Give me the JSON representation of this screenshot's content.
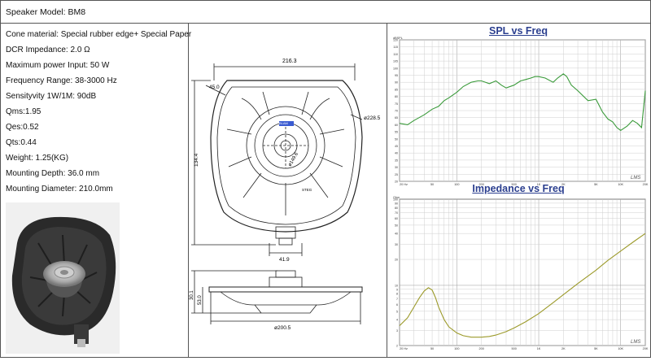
{
  "header": {
    "model": "Speaker Model: BM8"
  },
  "specs": [
    "Cone material: Special rubber edge+ Special Paper",
    "DCR Impedance: 2.0 Ω",
    "Maximum power Input: 50 W",
    "Frequency Range: 38-3000 Hz",
    "Sensityvity 1W/1M: 90dB",
    "Qms:1.95",
    "Qes:0.52",
    "Qts:0.44",
    "Weight: 1.25(KG)",
    "Mounting Depth: 36.0 mm",
    "Mounting Diameter: 210.0mm"
  ],
  "drawing": {
    "dim_width": "216.3",
    "dim_angle": "45.0",
    "dim_outer_dia": "ø228.5",
    "dim_inner": "ø149.6",
    "dim_height": "134.4",
    "dim_terminal": "41.9",
    "dim_depth1": "30.1",
    "dim_depth2": "53.0",
    "dim_base_dia": "ø200.5",
    "label_sticker": "BLAM",
    "label_brand": "STEG"
  },
  "chart_data": [
    {
      "type": "line",
      "title": "SPL vs Freq",
      "ylabel": "dBSPL",
      "watermark": "LMS",
      "xscale": "log",
      "xlim": [
        20,
        20000
      ],
      "ylim": [
        20,
        120
      ],
      "yticks": [
        20,
        25,
        30,
        35,
        40,
        45,
        50,
        55,
        60,
        65,
        70,
        75,
        80,
        85,
        90,
        95,
        100,
        105,
        110,
        115,
        120
      ],
      "xtick_labels": [
        {
          "v": 20,
          "t": "20 Hz"
        },
        {
          "v": 50,
          "t": "50"
        },
        {
          "v": 100,
          "t": "100"
        },
        {
          "v": 200,
          "t": "200"
        },
        {
          "v": 500,
          "t": "500"
        },
        {
          "v": 1000,
          "t": "1K"
        },
        {
          "v": 2000,
          "t": "2K"
        },
        {
          "v": 5000,
          "t": "5K"
        },
        {
          "v": 10000,
          "t": "10K"
        },
        {
          "v": 20000,
          "t": "20K"
        }
      ],
      "color": "#3a9a3a",
      "grid": true,
      "series": [
        {
          "x": [
            20,
            25,
            30,
            40,
            50,
            60,
            70,
            80,
            100,
            120,
            150,
            180,
            200,
            250,
            300,
            350,
            400,
            500,
            600,
            700,
            800,
            900,
            1000,
            1200,
            1500,
            1700,
            2000,
            2200,
            2500,
            3000,
            4000,
            5000,
            6000,
            7000,
            8000,
            9000,
            10000,
            12000,
            14000,
            16000,
            18000,
            20000
          ],
          "y": [
            61,
            60,
            63,
            67,
            71,
            73,
            77,
            79,
            83,
            87,
            90,
            91,
            91,
            89,
            91,
            88,
            86,
            88,
            91,
            92,
            93,
            94,
            94,
            93,
            90,
            93,
            96,
            94,
            88,
            84,
            77,
            78,
            69,
            64,
            62,
            58,
            56,
            59,
            63,
            61,
            58,
            84
          ]
        }
      ]
    },
    {
      "type": "line",
      "title": "Impedance vs Freq",
      "ylabel": "Ohm",
      "watermark": "LMS",
      "xscale": "log",
      "yscale": "log",
      "xlim": [
        20,
        20000
      ],
      "ylim": [
        2,
        100
      ],
      "ytick_labels": [
        {
          "v": 2,
          "t": "2"
        },
        {
          "v": 3,
          "t": "3"
        },
        {
          "v": 4,
          "t": "4"
        },
        {
          "v": 5,
          "t": "5"
        },
        {
          "v": 6,
          "t": "6"
        },
        {
          "v": 7,
          "t": "7"
        },
        {
          "v": 8,
          "t": "8"
        },
        {
          "v": 9,
          "t": "9"
        },
        {
          "v": 10,
          "t": "10"
        },
        {
          "v": 20,
          "t": "20"
        },
        {
          "v": 30,
          "t": "30"
        },
        {
          "v": 40,
          "t": "40"
        },
        {
          "v": 50,
          "t": "50"
        },
        {
          "v": 60,
          "t": "60"
        },
        {
          "v": 70,
          "t": "70"
        },
        {
          "v": 80,
          "t": "80"
        },
        {
          "v": 90,
          "t": "90"
        },
        {
          "v": 100,
          "t": "100"
        }
      ],
      "xtick_labels": [
        {
          "v": 20,
          "t": "20 Hz"
        },
        {
          "v": 50,
          "t": "50"
        },
        {
          "v": 100,
          "t": "100"
        },
        {
          "v": 200,
          "t": "200"
        },
        {
          "v": 500,
          "t": "500"
        },
        {
          "v": 1000,
          "t": "1K"
        },
        {
          "v": 2000,
          "t": "2K"
        },
        {
          "v": 5000,
          "t": "5K"
        },
        {
          "v": 10000,
          "t": "10K"
        },
        {
          "v": 20000,
          "t": "20K"
        }
      ],
      "color": "#9c9a2a",
      "grid": true,
      "series": [
        {
          "x": [
            20,
            25,
            30,
            35,
            40,
            45,
            50,
            55,
            60,
            70,
            80,
            100,
            120,
            150,
            200,
            250,
            300,
            400,
            500,
            700,
            1000,
            1500,
            2000,
            3000,
            5000,
            7000,
            10000,
            15000,
            20000
          ],
          "y": [
            3.4,
            4.2,
            5.6,
            7.2,
            8.6,
            9.4,
            8.8,
            7.2,
            5.6,
            4.0,
            3.3,
            2.8,
            2.6,
            2.5,
            2.5,
            2.55,
            2.65,
            2.9,
            3.2,
            3.8,
            4.7,
            6.3,
            7.8,
            10.5,
            15,
            19.5,
            25,
            33,
            40
          ]
        }
      ]
    }
  ]
}
